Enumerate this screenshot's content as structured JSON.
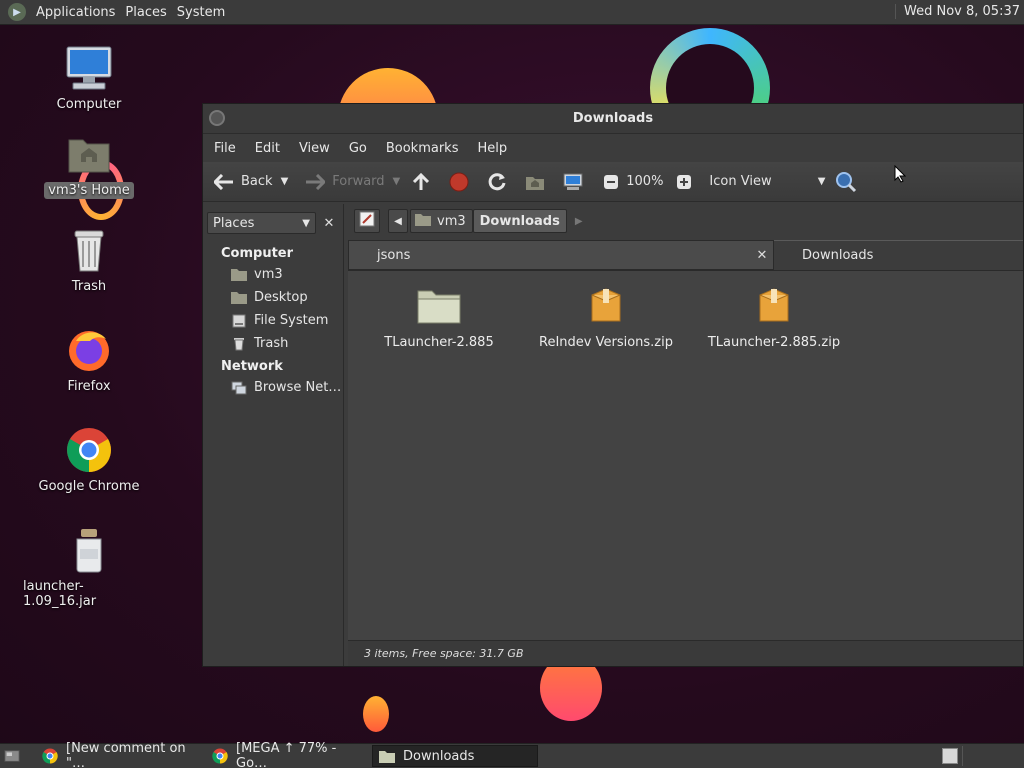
{
  "top_panel": {
    "menus": [
      "Applications",
      "Places",
      "System"
    ],
    "clock": "Wed Nov 8, 05:37"
  },
  "desktop": {
    "icons": [
      {
        "label": "Computer",
        "icon": "computer-icon"
      },
      {
        "label": "vm3's Home",
        "icon": "home-folder-icon"
      },
      {
        "label": "Trash",
        "icon": "trash-icon"
      },
      {
        "label": "Firefox",
        "icon": "firefox-icon"
      },
      {
        "label": "Google Chrome",
        "icon": "chrome-icon"
      },
      {
        "label": "launcher-1.09_16.jar",
        "icon": "jar-icon"
      }
    ]
  },
  "window": {
    "title": "Downloads",
    "menu": [
      "File",
      "Edit",
      "View",
      "Go",
      "Bookmarks",
      "Help"
    ],
    "toolbar": {
      "back": "Back",
      "forward": "Forward",
      "zoom": "100%",
      "view_mode": "Icon View"
    },
    "sidebar": {
      "combo": "Places",
      "sections": [
        {
          "title": "Computer",
          "items": [
            "vm3",
            "Desktop",
            "File System",
            "Trash"
          ]
        },
        {
          "title": "Network",
          "items": [
            "Browse Net…"
          ]
        }
      ]
    },
    "path": [
      "vm3",
      "Downloads"
    ],
    "tabs": [
      "jsons",
      "Downloads"
    ],
    "files": [
      {
        "name": "TLauncher-2.885",
        "type": "folder"
      },
      {
        "name": "ReIndev Versions.zip",
        "type": "zip"
      },
      {
        "name": "TLauncher-2.885.zip",
        "type": "zip"
      }
    ],
    "status": "3 items, Free space: 31.7 GB"
  },
  "taskbar": {
    "tasks": [
      "[New comment on \"…",
      "[MEGA ↑ 77% - Go…",
      "Downloads"
    ]
  },
  "colors": {
    "panel": "#3b3b3b",
    "window_bg": "#3c3c3c",
    "content_bg": "#434343",
    "wallpaper": "#250a1d",
    "zip_icon": "#e8a33a"
  }
}
